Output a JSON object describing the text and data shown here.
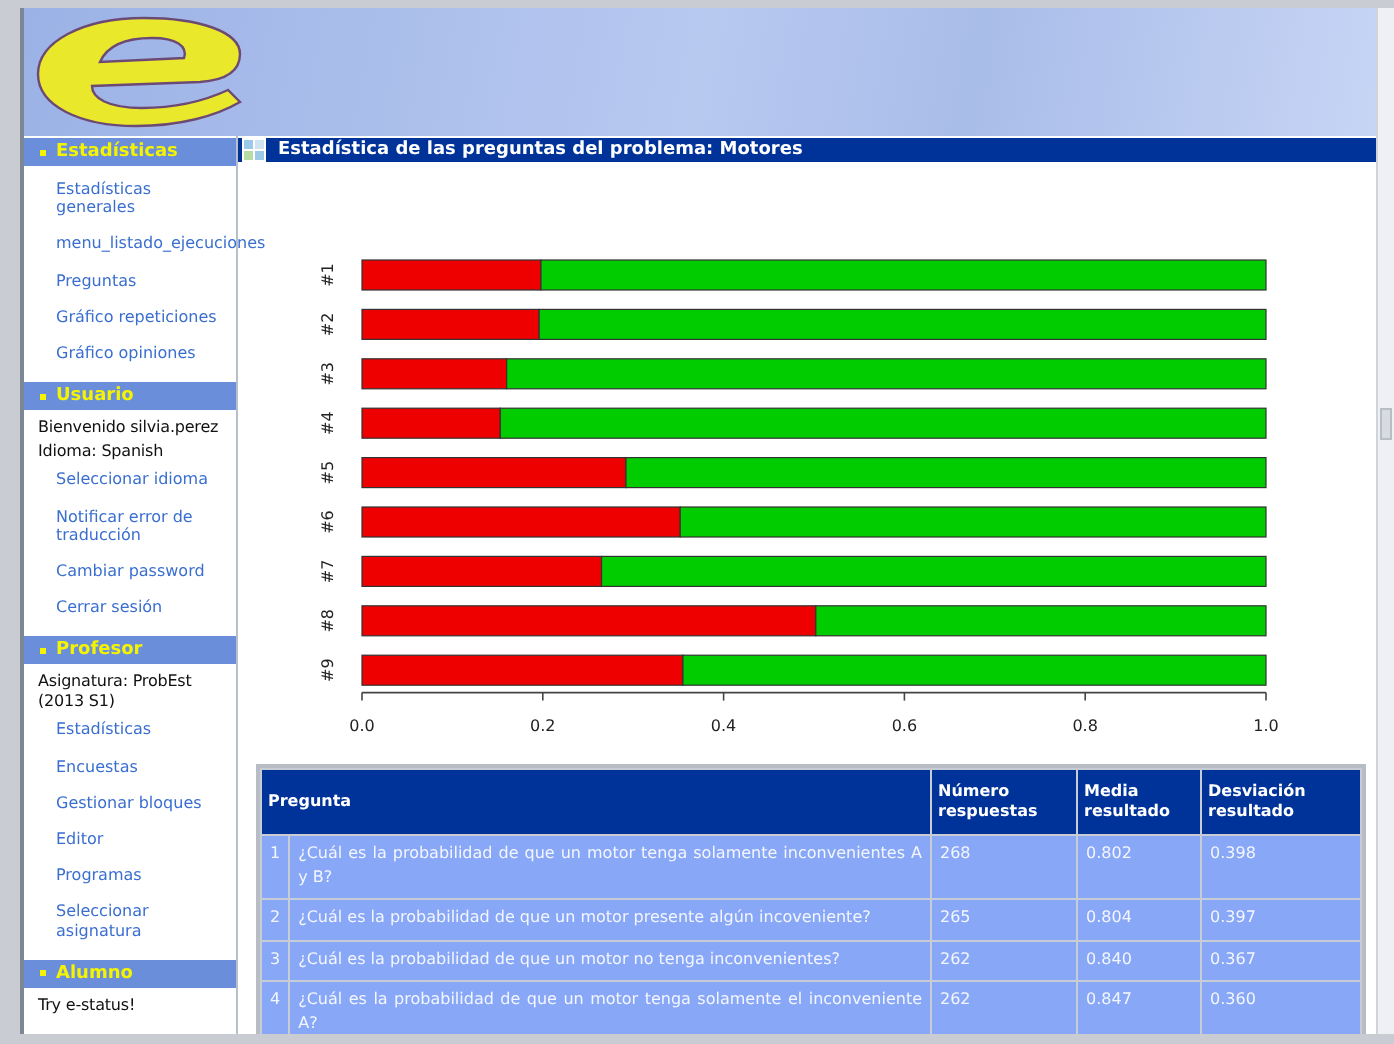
{
  "sidebar": {
    "sections": [
      {
        "title": "Estadísticas",
        "items": [
          {
            "kind": "link",
            "label": "Estadísticas generales"
          },
          {
            "kind": "link",
            "label": "menu_listado_ejecuciones"
          },
          {
            "kind": "link",
            "label": "Preguntas"
          },
          {
            "kind": "link",
            "label": "Gráfico repeticiones"
          },
          {
            "kind": "link",
            "label": "Gráfico opiniones"
          }
        ]
      },
      {
        "title": "Usuario",
        "items": [
          {
            "kind": "text",
            "label": "Bienvenido silvia.perez"
          },
          {
            "kind": "text",
            "label": "Idioma: Spanish"
          },
          {
            "kind": "link",
            "label": "Seleccionar idioma"
          },
          {
            "kind": "link",
            "label": "Notificar error de traducción"
          },
          {
            "kind": "link",
            "label": "Cambiar password"
          },
          {
            "kind": "link",
            "label": "Cerrar sesión"
          }
        ]
      },
      {
        "title": "Profesor",
        "items": [
          {
            "kind": "text",
            "label": "Asignatura: ProbEst (2013 S1)"
          },
          {
            "kind": "link",
            "label": "Estadísticas"
          },
          {
            "kind": "link",
            "label": "Encuestas"
          },
          {
            "kind": "link",
            "label": "Gestionar bloques"
          },
          {
            "kind": "link",
            "label": "Editor"
          },
          {
            "kind": "link",
            "label": "Programas"
          },
          {
            "kind": "link",
            "label": "Seleccionar asignatura"
          }
        ]
      },
      {
        "title": "Alumno",
        "items": [
          {
            "kind": "text",
            "label": "Try e-status!"
          }
        ]
      }
    ]
  },
  "panel": {
    "title": "Estadística de las preguntas del problema: Motores",
    "chart_data": {
      "type": "bar",
      "orientation": "horizontal",
      "stacked": true,
      "categories": [
        "#1",
        "#2",
        "#3",
        "#4",
        "#5",
        "#6",
        "#7",
        "#8",
        "#9"
      ],
      "series": [
        {
          "color": "#ee0000",
          "values": [
            0.198,
            0.196,
            0.16,
            0.153,
            0.292,
            0.352,
            0.265,
            0.502,
            0.355
          ]
        },
        {
          "color": "#00cc00",
          "values": [
            0.802,
            0.804,
            0.84,
            0.847,
            0.708,
            0.648,
            0.735,
            0.498,
            0.645
          ]
        }
      ],
      "xlim": [
        0,
        1
      ],
      "xticks": [
        {
          "value": 0,
          "label": "0.0"
        },
        {
          "value": 0.2,
          "label": "0.2"
        },
        {
          "value": 0.4,
          "label": "0.4"
        },
        {
          "value": 0.6,
          "label": "0.6"
        },
        {
          "value": 0.8,
          "label": "0.8"
        },
        {
          "value": 1,
          "label": "1.0"
        }
      ]
    }
  },
  "table": {
    "columns": [
      "Pregunta",
      "Número respuestas",
      "Media resultado",
      "Desviación resultado"
    ],
    "rows": [
      {
        "index": "1",
        "pregunta": "¿Cuál es la probabilidad de que un motor tenga solamente inconvenientes A y B?",
        "respuestas": "268",
        "media": "0.802",
        "desviacion": "0.398"
      },
      {
        "index": "2",
        "pregunta": "¿Cuál es la probabilidad de que un motor presente algún incoveniente?",
        "respuestas": "265",
        "media": "0.804",
        "desviacion": "0.397"
      },
      {
        "index": "3",
        "pregunta": "¿Cuál es la probabilidad de que un motor no tenga inconvenientes?",
        "respuestas": "262",
        "media": "0.840",
        "desviacion": "0.367"
      },
      {
        "index": "4",
        "pregunta": "¿Cuál es la probabilidad de que un motor tenga solamente el inconveniente A?",
        "respuestas": "262",
        "media": "0.847",
        "desviacion": "0.360"
      }
    ]
  }
}
